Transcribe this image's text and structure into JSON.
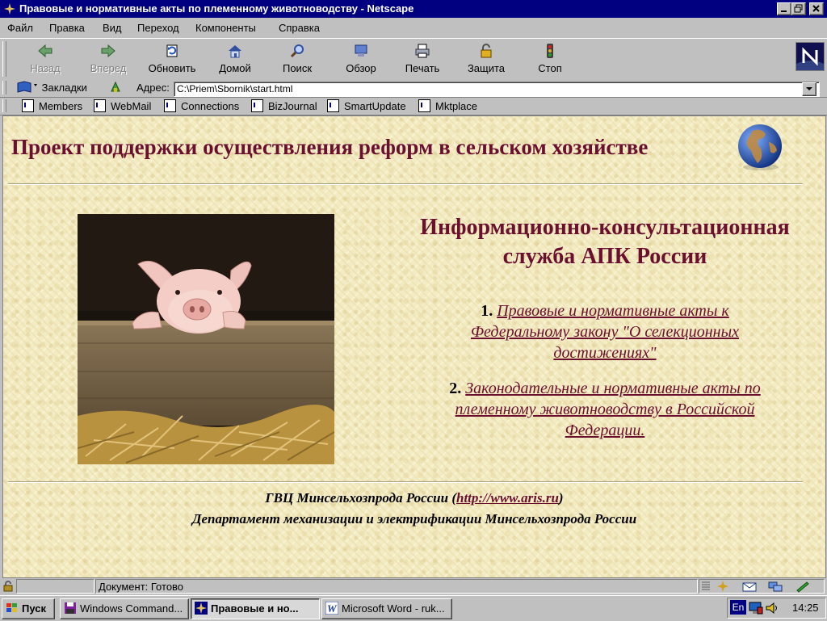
{
  "window": {
    "title": "Правовые и нормативные акты по племенному животноводству - Netscape"
  },
  "menu": [
    "Файл",
    "Правка",
    "Вид",
    "Переход",
    "Компоненты",
    "Справка"
  ],
  "toolbar": {
    "back": "Назад",
    "forward": "Вперед",
    "reload": "Обновить",
    "home": "Домой",
    "search": "Поиск",
    "guide": "Обзор",
    "print": "Печать",
    "security": "Защита",
    "stop": "Стоп"
  },
  "location": {
    "bookmarks_label": "Закладки",
    "address_label": "Адрес:",
    "url": "C:\\Priem\\Sbornik\\start.html"
  },
  "personal_toolbar": [
    "Members",
    "WebMail",
    "Connections",
    "BizJournal",
    "SmartUpdate",
    "Mktplace"
  ],
  "page": {
    "heading": "Проект поддержки осуществления реформ в сельском хозяйстве",
    "service_line1": "Информационно-консультационная",
    "service_line2": "служба АПК России",
    "items": [
      {
        "num": "1.",
        "text": "Правовые и нормативные акты к Федеральному закону  \"О селекционных достижениях\""
      },
      {
        "num": "2.",
        "text": "Законодательные и нормативные акты по племенному животноводству в Российской Федерации."
      }
    ],
    "footer": {
      "line1_prefix": "ГВЦ Минсельхозпрода России (",
      "line1_link": "http://www.aris.ru",
      "line1_suffix": ")",
      "line2": "Департамент механизации и электрификации Минсельхозпрода России"
    }
  },
  "status": {
    "text": "Документ: Готово"
  },
  "taskbar": {
    "start": "Пуск",
    "tasks": [
      {
        "label": "Windows Command..."
      },
      {
        "label": "Правовые и но..."
      },
      {
        "label": "Microsoft Word - ruk..."
      }
    ],
    "lang": "En",
    "clock": "14:25"
  },
  "colors": {
    "titlebar": "#000080",
    "accent_maroon": "#6b0f2f",
    "page_bg": "#f2ebc3"
  }
}
